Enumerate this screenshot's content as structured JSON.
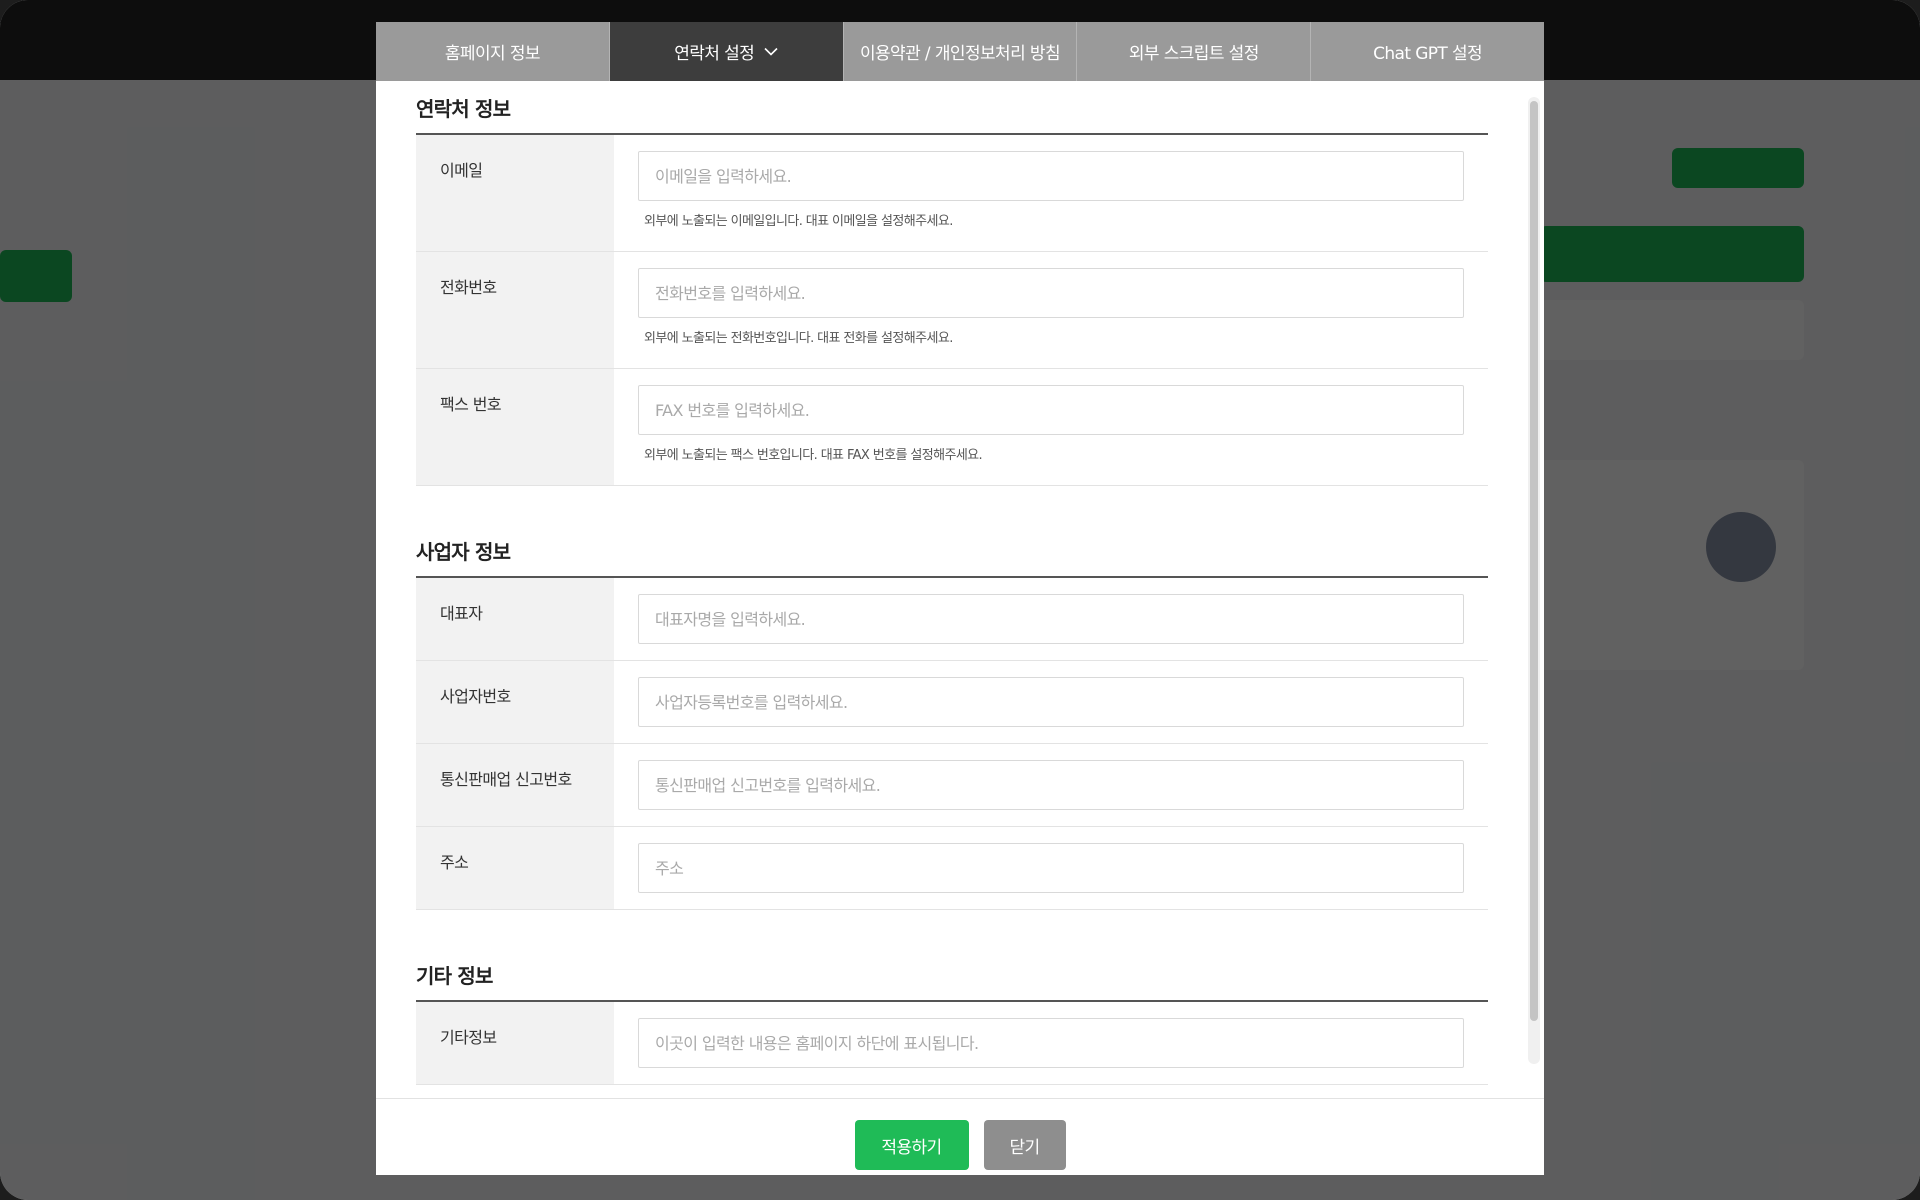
{
  "colors": {
    "accent": "#1fbb57",
    "active_tab": "#3d3d3d",
    "tab_bar": "#9a9a9a",
    "close_button": "#8e8e8e"
  },
  "tabs": [
    {
      "label": "홈페이지 정보",
      "active": false
    },
    {
      "label": "연락처 설정",
      "active": true,
      "icon": "chevron-down-icon"
    },
    {
      "label": "이용약관 / 개인정보처리 방침",
      "active": false
    },
    {
      "label": "외부 스크립트 설정",
      "active": false
    },
    {
      "label": "Chat GPT 설정",
      "active": false
    }
  ],
  "contact": {
    "title": "연락처 정보",
    "email": {
      "label": "이메일",
      "placeholder": "이메일을 입력하세요.",
      "hint": "외부에 노출되는 이메일입니다. 대표 이메일을 설정해주세요."
    },
    "phone": {
      "label": "전화번호",
      "placeholder": "전화번호를 입력하세요.",
      "hint": "외부에 노출되는 전화번호입니다. 대표 전화를 설정해주세요."
    },
    "fax": {
      "label": "팩스 번호",
      "placeholder": "FAX 번호를 입력하세요.",
      "hint": "외부에 노출되는 팩스 번호입니다. 대표 FAX 번호를 설정해주세요."
    }
  },
  "business": {
    "title": "사업자 정보",
    "ceo": {
      "label": "대표자",
      "placeholder": "대표자명을 입력하세요."
    },
    "reg_no": {
      "label": "사업자번호",
      "placeholder": "사업자등록번호를 입력하세요."
    },
    "ecommerce_no": {
      "label": "통신판매업 신고번호",
      "placeholder": "통신판매업 신고번호를 입력하세요."
    },
    "address": {
      "label": "주소",
      "placeholder": "주소"
    }
  },
  "etc": {
    "title": "기타 정보",
    "info": {
      "label": "기타정보",
      "placeholder": "이곳이 입력한 내용은 홈페이지 하단에 표시됩니다."
    }
  },
  "footer": {
    "apply_label": "적용하기",
    "close_label": "닫기"
  }
}
